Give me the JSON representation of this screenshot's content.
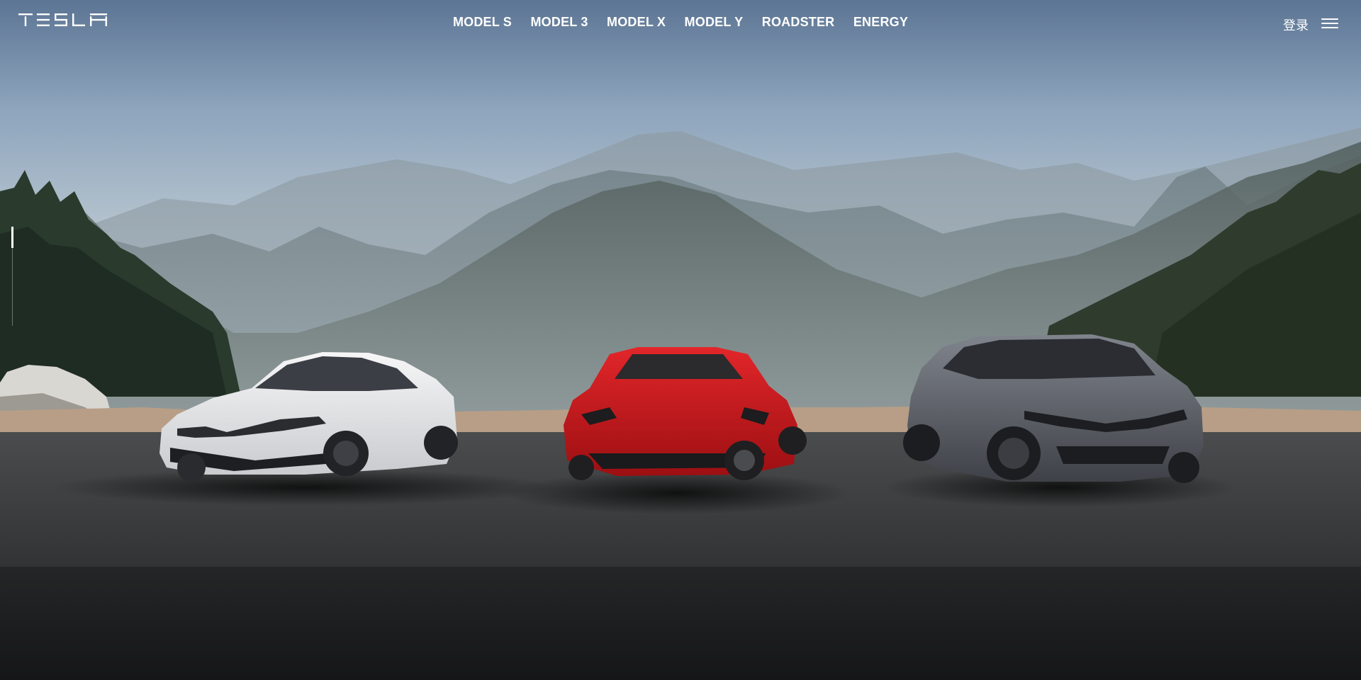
{
  "header": {
    "logo_text": "TESLA",
    "nav": [
      {
        "label": "MODEL S"
      },
      {
        "label": "MODEL 3"
      },
      {
        "label": "MODEL X"
      },
      {
        "label": "MODEL Y"
      },
      {
        "label": "ROADSTER"
      },
      {
        "label": "ENERGY"
      }
    ],
    "login_label": "登录",
    "menu_icon": "hamburger-menu-icon"
  },
  "hero": {
    "slide_indicator": {
      "current": 1
    },
    "cars": [
      {
        "name": "white-sedan",
        "color": "#e6e7e9"
      },
      {
        "name": "red-sedan",
        "color": "#c8171b"
      },
      {
        "name": "grey-suv",
        "color": "#5d6169"
      }
    ]
  },
  "colors": {
    "sky_top": "#5f7897",
    "sky_mid": "#a9bccc",
    "asphalt": "#2f3133",
    "text": "#ffffff"
  }
}
